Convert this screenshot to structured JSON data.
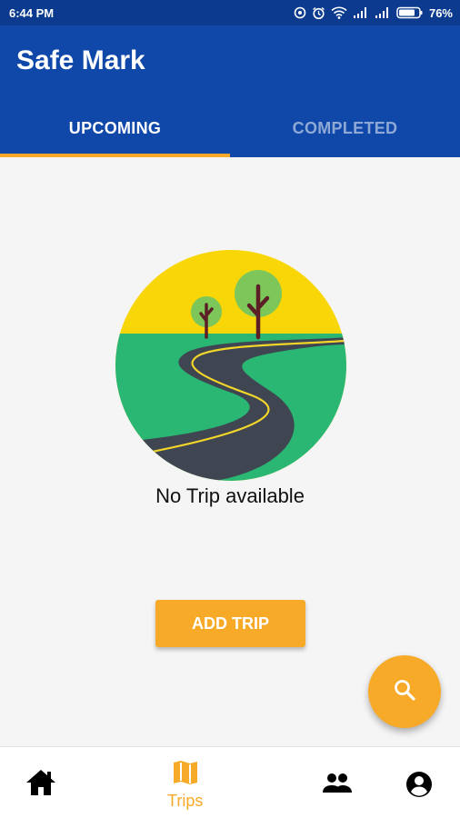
{
  "status_bar": {
    "time": "6:44 PM",
    "battery": "76%",
    "icons": [
      "location-icon",
      "alarm-icon",
      "wifi-icon",
      "signal-icon",
      "signal-icon",
      "battery-icon"
    ]
  },
  "app_bar": {
    "title": "Safe Mark",
    "background_color": "#0f48a8"
  },
  "tabs": [
    {
      "label": "UPCOMING",
      "active": true
    },
    {
      "label": "COMPLETED",
      "active": false
    }
  ],
  "main": {
    "illustration_icon": "road-illustration",
    "empty_message": "No Trip available",
    "add_trip_label": "ADD TRIP",
    "fab_icon": "search-icon"
  },
  "bottom_nav": {
    "items": [
      {
        "icon": "home-icon",
        "label": ""
      },
      {
        "icon": "map-icon",
        "label": "Trips",
        "active": true
      },
      {
        "icon": "group-icon",
        "label": ""
      },
      {
        "icon": "account-icon",
        "label": ""
      }
    ]
  },
  "colors": {
    "accent": "#f7a928",
    "primary": "#0f48a8",
    "status_bar": "#0b3a8f"
  }
}
